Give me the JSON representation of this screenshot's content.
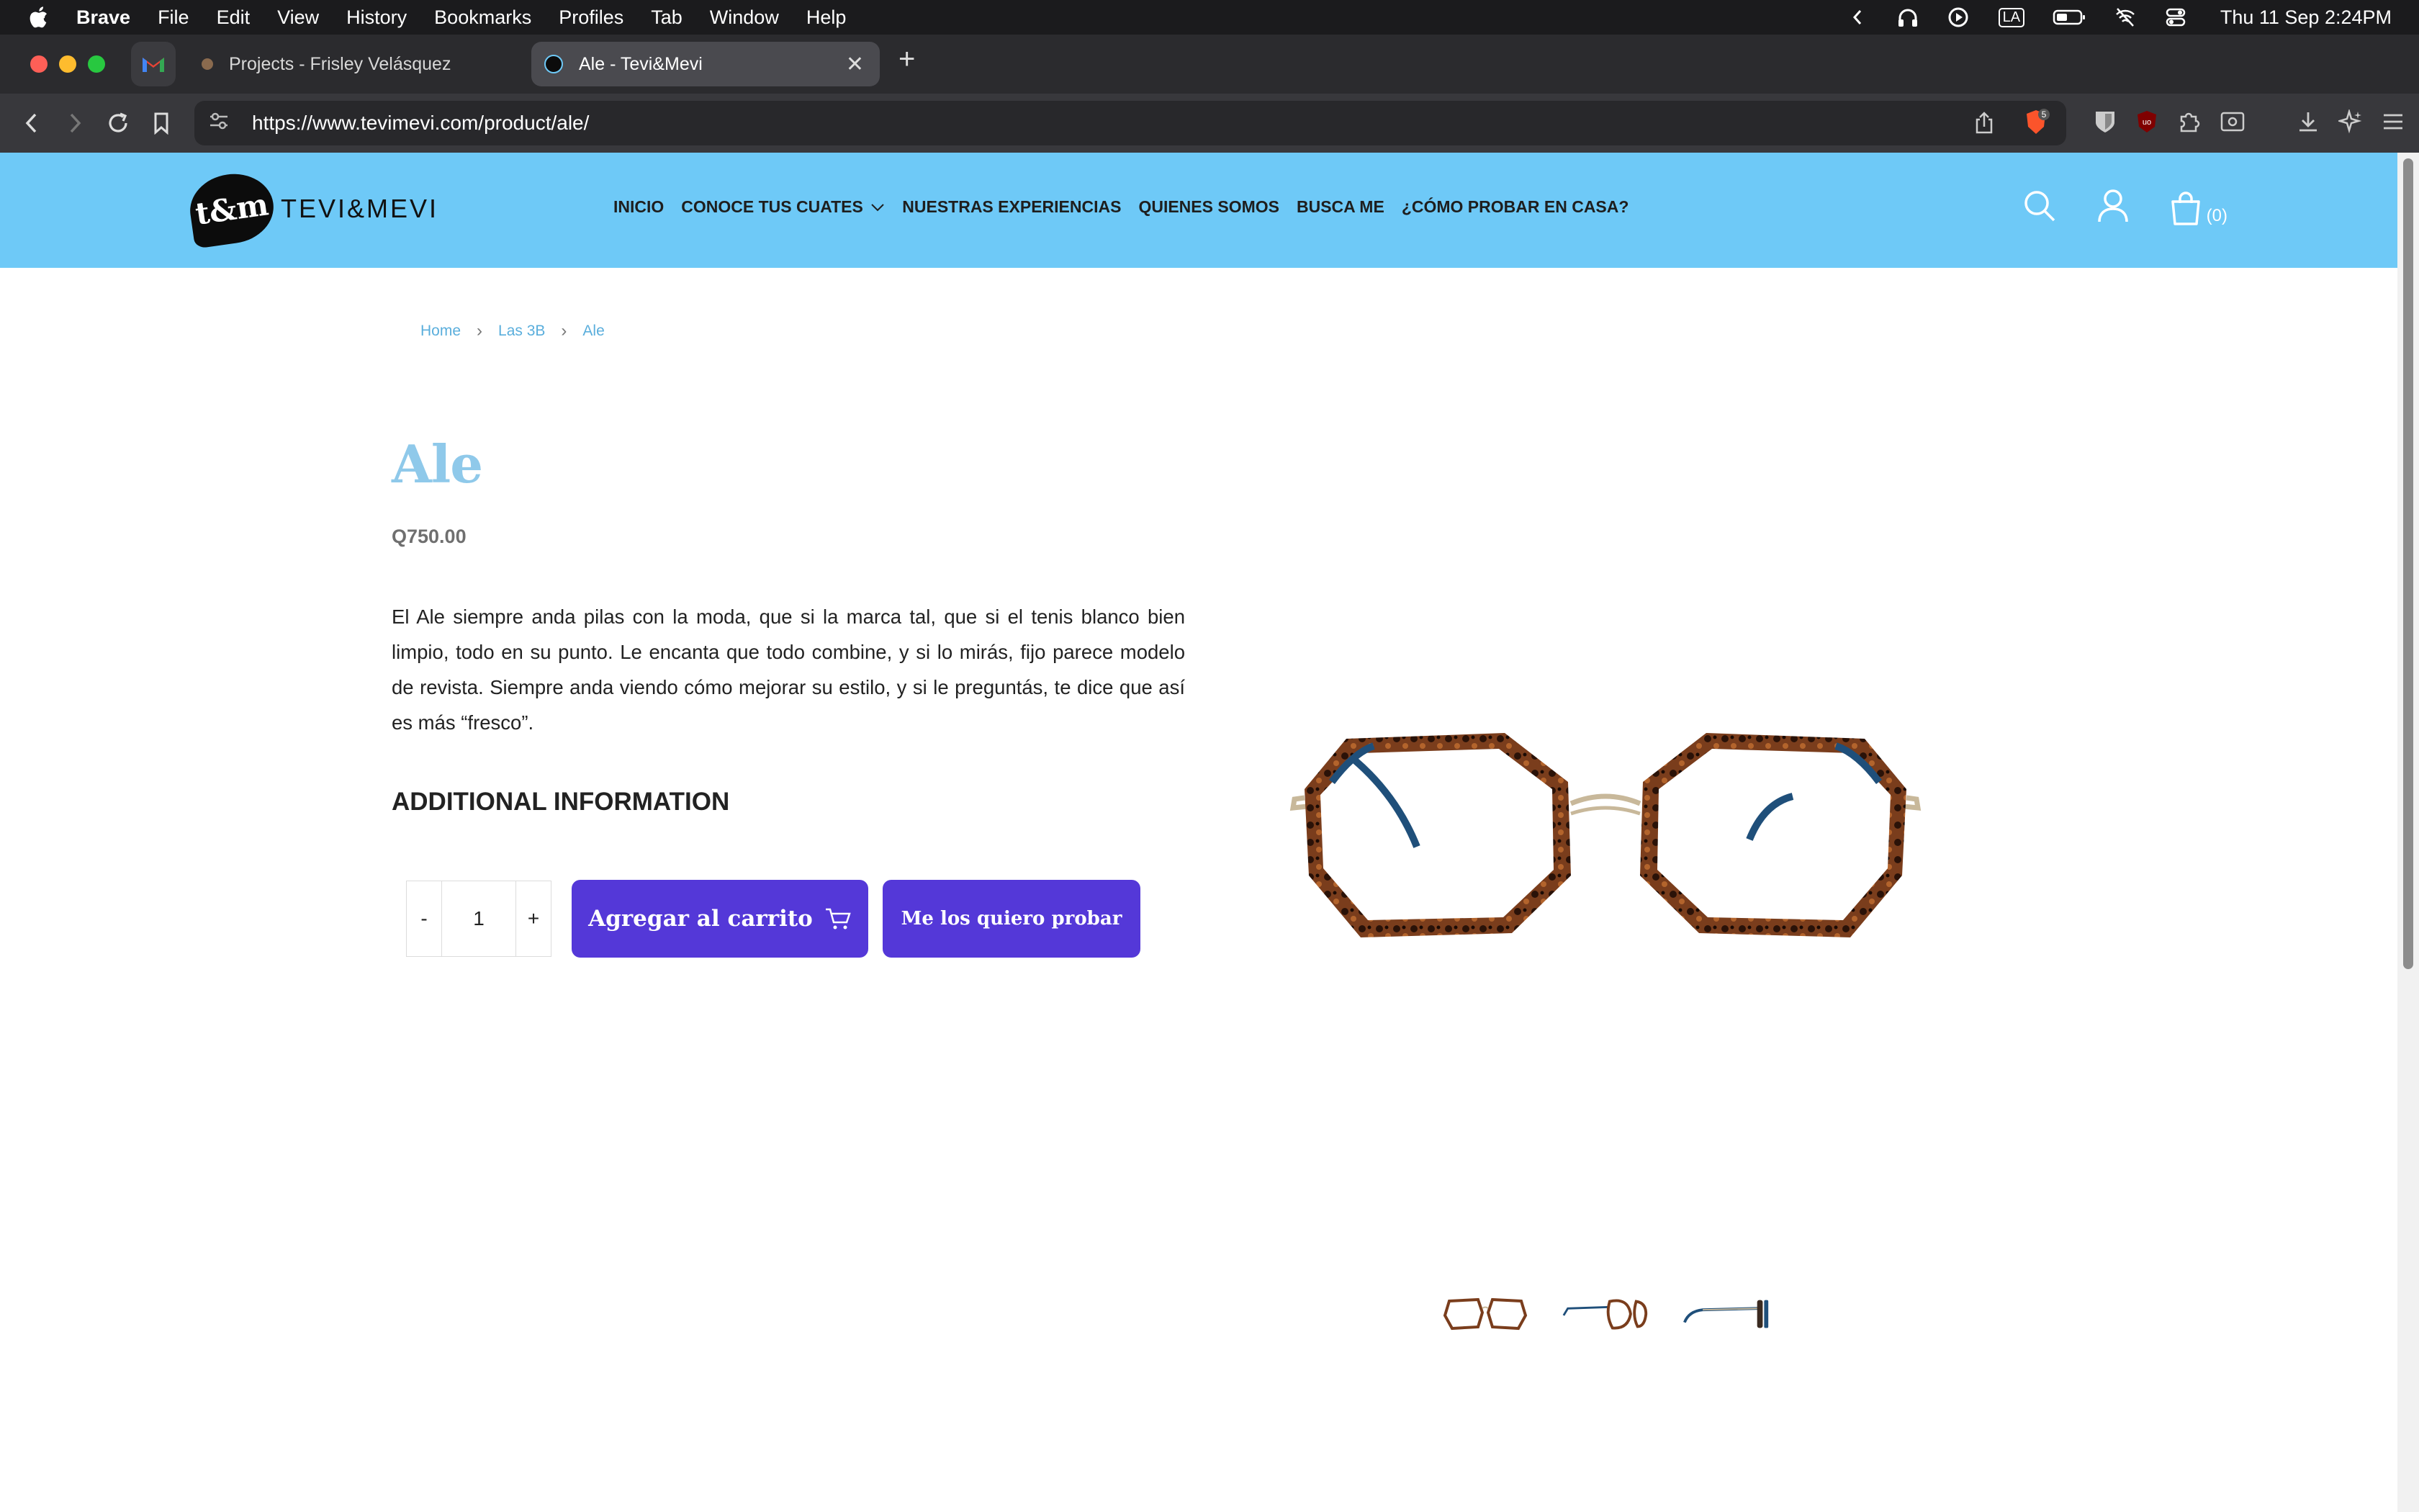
{
  "menubar": {
    "app_name": "Brave",
    "items": [
      "File",
      "Edit",
      "View",
      "History",
      "Bookmarks",
      "Profiles",
      "Tab",
      "Window",
      "Help"
    ],
    "input_source": "LA",
    "clock": "Thu 11 Sep  2:24PM"
  },
  "browser": {
    "tabs": [
      {
        "title": "Projects - Frisley Velásquez",
        "active": false
      },
      {
        "title": "Ale - Tevi&Mevi",
        "active": true
      }
    ],
    "url": "https://www.tevimevi.com/product/ale/",
    "shield_badge": "5"
  },
  "site": {
    "logo_mark": "t&m",
    "logo_text": "TEVI&MEVI",
    "nav": [
      "INICIO",
      "CONOCE TUS CUATES",
      "NUESTRAS EXPERIENCIAS",
      "QUIENES SOMOS",
      "BUSCA ME",
      "¿CÓMO PROBAR EN CASA?"
    ],
    "cart_count": "(0)"
  },
  "product": {
    "breadcrumb": [
      "Home",
      "Las 3B",
      "Ale"
    ],
    "title": "Ale",
    "price": "Q750.00",
    "description": "El Ale siempre anda pilas con la moda, que si la marca tal, que si el tenis blanco bien limpio, todo en su punto. Le encanta que todo combine, y si lo mirás, fijo parece modelo de revista. Siempre anda viendo cómo mejorar su estilo, y si le preguntás, te dice que así es más “fresco”.",
    "additional_info_heading": "ADDITIONAL INFORMATION",
    "quantity": {
      "minus": "-",
      "value": "1",
      "plus": "+"
    },
    "add_to_cart_label": "Agregar al carrito",
    "try_label": "Me los quiero probar"
  },
  "colors": {
    "header_bg": "#6ec9f7",
    "title": "#8fc9ea",
    "button": "#5438d8",
    "breadcrumb": "#5aaedc"
  }
}
